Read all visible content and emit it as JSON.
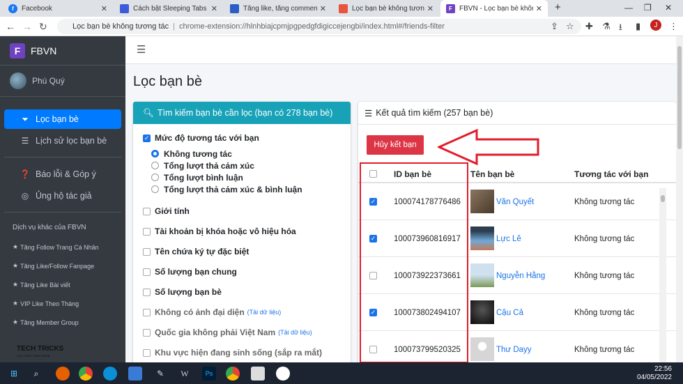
{
  "browser": {
    "tabs": [
      {
        "title": "Facebook",
        "icon": "facebook-icon",
        "color": "#1877f2"
      },
      {
        "title": "Cách bật Sleeping Tabs với G",
        "icon": "page-icon",
        "color": "#3b5bdb"
      },
      {
        "title": "Tăng like, tăng comment, tăng",
        "icon": "page-icon",
        "color": "#2c5cc5"
      },
      {
        "title": "Lọc bạn bè không tương tác",
        "icon": "page-icon",
        "color": "#e8543c"
      },
      {
        "title": "FBVN - Lọc bạn bè không tư",
        "icon": "fbvn-icon",
        "color": "#6f42c1"
      }
    ],
    "new_tab": "+",
    "address": {
      "title": "Lọc bạn bè không tương tác",
      "url": "chrome-extension://hlnhbiajcpmjpgpedgfdigiccejengbi/index.html#/friends-filter"
    },
    "profile_initial": "J"
  },
  "sidebar": {
    "brand_logo": "F",
    "brand": "FBVN",
    "user": "Phú Quý",
    "menu": [
      {
        "label": "Lọc bạn bè",
        "icon": "filter-icon",
        "glyph": "⏷",
        "active": true
      },
      {
        "label": "Lịch sử lọc bạn bè",
        "icon": "list-icon",
        "glyph": "☰",
        "active": false
      },
      {
        "label": "Báo lỗi & Góp ý",
        "icon": "question-icon",
        "glyph": "❓",
        "active": false
      },
      {
        "label": "Ủng hộ tác giả",
        "icon": "coin-icon",
        "glyph": "◎",
        "active": false
      }
    ],
    "services_title": "Dịch vụ khác của FBVN",
    "services": [
      "Tăng Follow Trang Cá Nhân",
      "Tăng Like/Follow Fanpage",
      "Tăng Like Bài viết",
      "VIP Like Theo Tháng",
      "Tăng Member Group"
    ],
    "watermark": "TECH TRICKS",
    "watermark_sub": "KHU THÍCH CÔNG NGHỆ"
  },
  "main": {
    "page_title": "Lọc bạn bè",
    "filter": {
      "title": "Tìm kiếm bạn bè cần lọc (bạn có 278 bạn bè)",
      "criteria": [
        {
          "label": "Mức độ tương tác với bạn",
          "checked": true,
          "dim": false,
          "options": [
            {
              "label": "Không tương tác",
              "selected": true
            },
            {
              "label": "Tổng lượt thả cảm xúc",
              "selected": false
            },
            {
              "label": "Tổng lượt bình luận",
              "selected": false
            },
            {
              "label": "Tổng lượt thả cảm xúc & bình luận",
              "selected": false
            }
          ]
        },
        {
          "label": "Giới tính",
          "checked": false,
          "dim": false
        },
        {
          "label": "Tài khoản bị khóa hoặc vô hiệu hóa",
          "checked": false,
          "dim": false
        },
        {
          "label": "Tên chứa ký tự đặc biệt",
          "checked": false,
          "dim": false
        },
        {
          "label": "Số lượng bạn chung",
          "checked": false,
          "dim": false
        },
        {
          "label": "Số lượng bạn bè",
          "checked": false,
          "dim": false
        },
        {
          "label": "Không có ảnh đại diện",
          "checked": false,
          "dim": true,
          "note": "(Tải dữ liệu)"
        },
        {
          "label": "Quốc gia không phải Việt Nam",
          "checked": false,
          "dim": true,
          "note": "(Tải dữ liệu)"
        },
        {
          "label": "Khu vực hiện đang sinh sống (sắp ra mắt)",
          "checked": false,
          "dim": true
        }
      ]
    },
    "results": {
      "title": "Kết quả tìm kiếm (257 bạn bè)",
      "unfriend_label": "Hủy kết bạn",
      "columns": [
        "ID bạn bè",
        "Tên bạn bè",
        "Tương tác với bạn"
      ],
      "rows": [
        {
          "id": "100074178776486",
          "name": "Văn Quyết",
          "interaction": "Không tương tác",
          "checked": true,
          "pic": "#6b5a4a"
        },
        {
          "id": "100073960816917",
          "name": "Lực Lê",
          "interaction": "Không tương tác",
          "checked": true,
          "pic": "#3f6fa0"
        },
        {
          "id": "100073922373661",
          "name": "Nguyễn Hằng",
          "interaction": "Không tương tác",
          "checked": false,
          "pic": "#9fb7c9"
        },
        {
          "id": "100073802494107",
          "name": "Cậu Cả",
          "interaction": "Không tương tác",
          "checked": true,
          "pic": "#1a1a1a"
        },
        {
          "id": "100073799520325",
          "name": "Thư Dayy",
          "interaction": "Không tương tác",
          "checked": false,
          "pic": "#c8c8c8"
        }
      ]
    }
  },
  "taskbar": {
    "time": "22:56",
    "date": "04/05/2022"
  },
  "colors": {
    "accent": "#007bff",
    "info": "#17a2b8",
    "danger": "#dc3545",
    "highlight": "#e21b2a"
  }
}
